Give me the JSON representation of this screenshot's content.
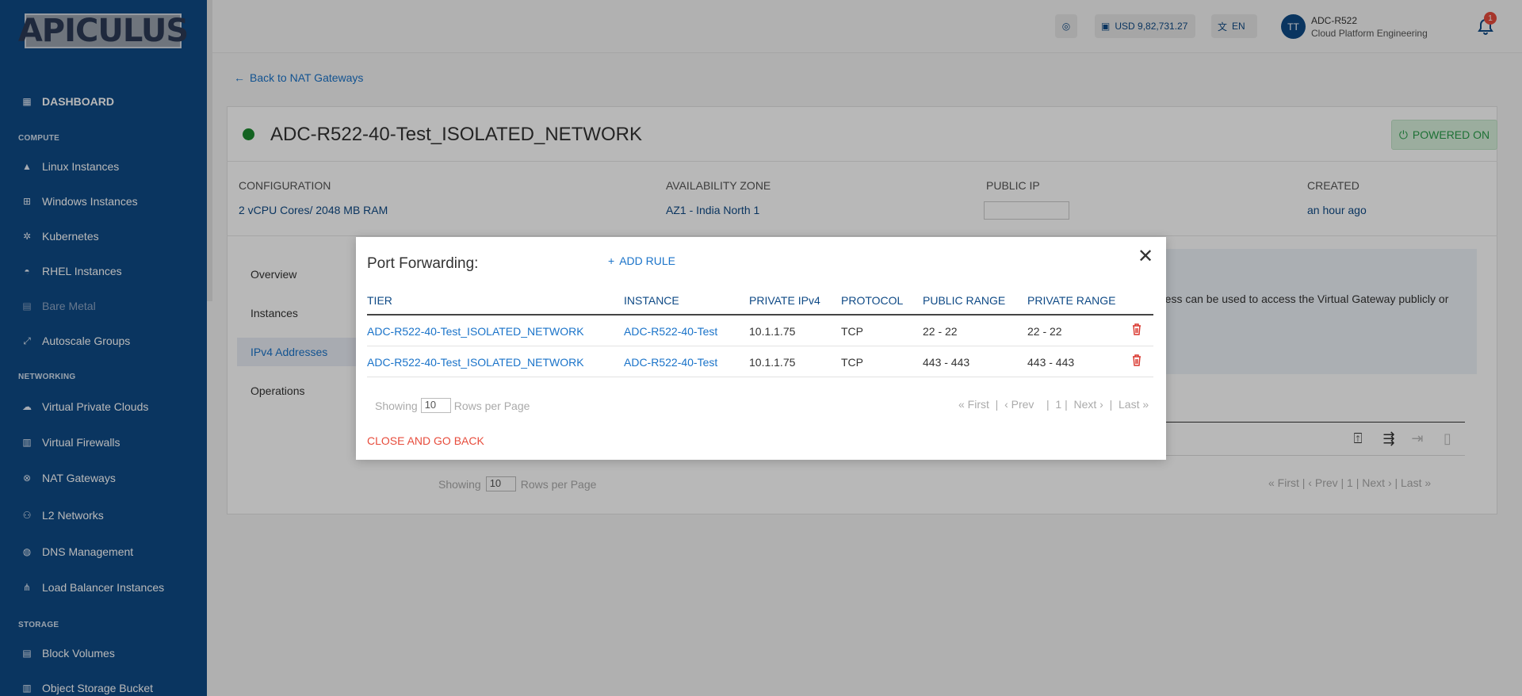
{
  "sidebar": {
    "logo": "APICULUS",
    "dashboard": "DASHBOARD",
    "sections": {
      "compute": "COMPUTE",
      "networking": "NETWORKING",
      "storage": "STORAGE"
    },
    "items": {
      "linux": "Linux Instances",
      "windows": "Windows Instances",
      "kubernetes": "Kubernetes",
      "rhel": "RHEL Instances",
      "bare_metal": "Bare Metal",
      "autoscale": "Autoscale Groups",
      "vpc": "Virtual Private Clouds",
      "firewalls": "Virtual Firewalls",
      "nat": "NAT Gateways",
      "l2": "L2 Networks",
      "dns": "DNS Management",
      "lb": "Load Balancer Instances",
      "block": "Block Volumes",
      "object": "Object Storage Bucket"
    }
  },
  "topbar": {
    "balance": "USD 9,82,731.27",
    "language": "EN",
    "avatar_initials": "TT",
    "user_name": "ADC-R522",
    "user_org": "Cloud Platform Engineering",
    "notification_count": "1"
  },
  "page": {
    "back_link": "Back to NAT Gateways",
    "title": "ADC-R522-40-Test_ISOLATED_NETWORK",
    "powered_status": "POWERED ON",
    "config_label": "CONFIGURATION",
    "config_value": "2 vCPU Cores/ 2048 MB RAM",
    "az_label": "AVAILABILITY ZONE",
    "az_value": "AZ1 - India North 1",
    "ip_label": "PUBLIC IP",
    "created_label": "CREATED",
    "created_value": "an hour ago",
    "tabs": {
      "overview": "Overview",
      "instances": "Instances",
      "ipv4": "IPv4 Addresses",
      "operations": "Operations"
    },
    "info_text": "ress can be used to access the Virtual Gateway publicly or",
    "bg_showing": "Showing",
    "bg_rows": "10",
    "bg_rows_label": "Rows per Page",
    "bg_pager": "« First  |  ‹ Prev  |  1 |  Next ›  |  Last »"
  },
  "modal": {
    "title": "Port Forwarding:",
    "add_rule": "ADD RULE",
    "columns": {
      "tier": "TIER",
      "instance": "INSTANCE",
      "private_ip": "PRIVATE IPv4",
      "protocol": "PROTOCOL",
      "public_range": "PUBLIC RANGE",
      "private_range": "PRIVATE RANGE"
    },
    "rows": [
      {
        "tier": "ADC-R522-40-Test_ISOLATED_NETWORK",
        "instance": "ADC-R522-40-Test",
        "private_ip": "10.1.1.75",
        "protocol": "TCP",
        "public_range": "22 - 22",
        "private_range": "22 - 22"
      },
      {
        "tier": "ADC-R522-40-Test_ISOLATED_NETWORK",
        "instance": "ADC-R522-40-Test",
        "private_ip": "10.1.1.75",
        "protocol": "TCP",
        "public_range": "443 - 443",
        "private_range": "443 - 443"
      }
    ],
    "showing": "Showing",
    "rows_per_page": "10",
    "rows_label": "Rows per Page",
    "pager": "« First  |  ‹ Prev    |  1 |  Next ›  |  Last »",
    "close_back": "CLOSE AND GO BACK"
  }
}
